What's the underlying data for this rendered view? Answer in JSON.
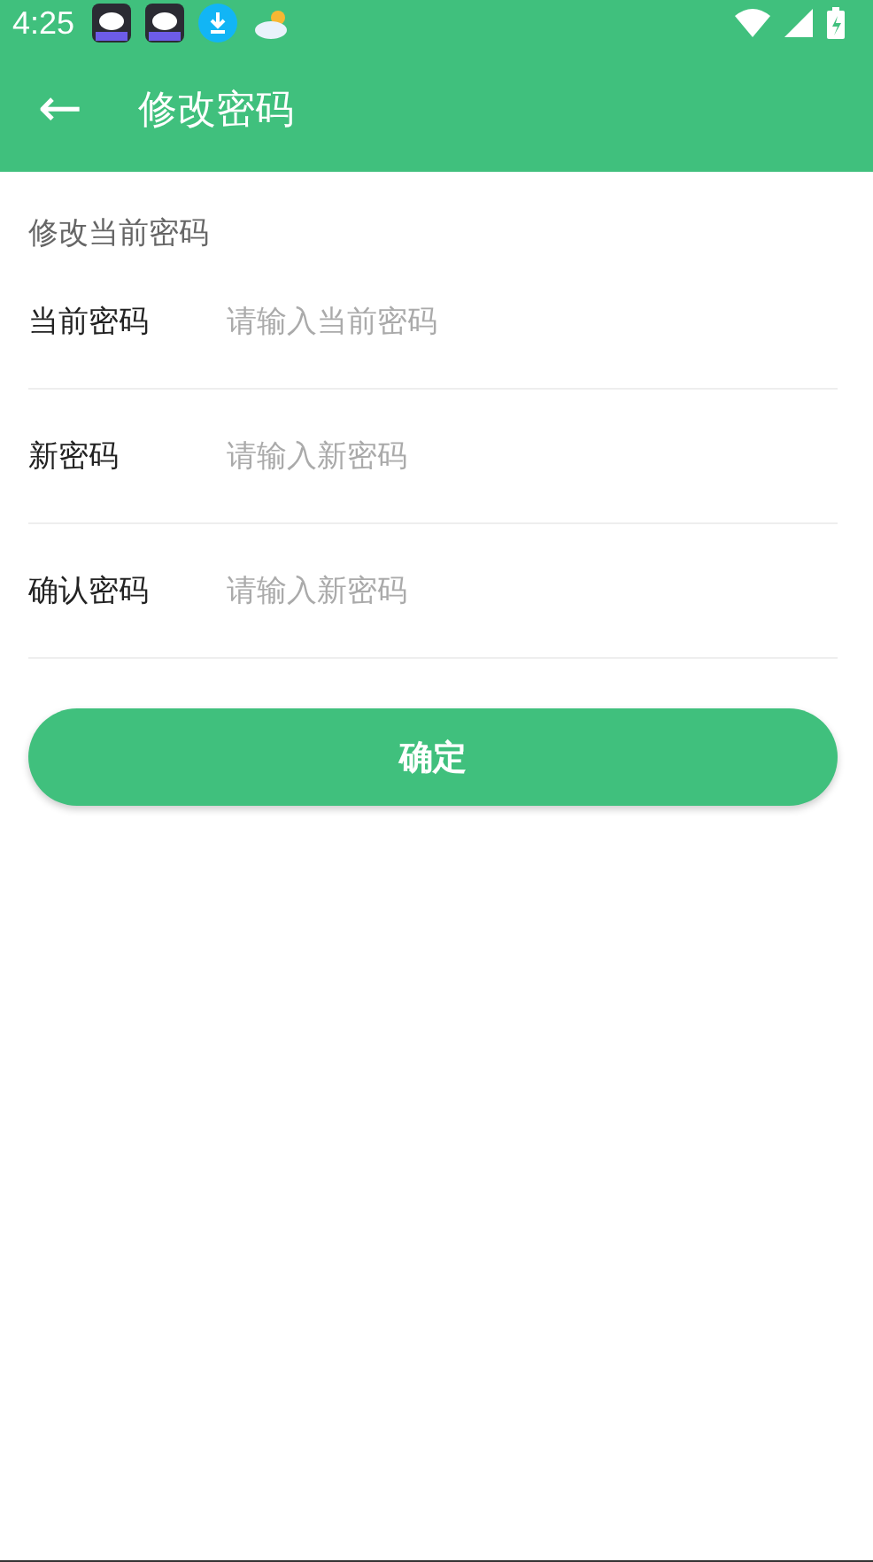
{
  "status_bar": {
    "time": "4:25"
  },
  "app_bar": {
    "back_icon": "←",
    "title": "修改密码"
  },
  "section_title": "修改当前密码",
  "fields": [
    {
      "label": "当前密码",
      "placeholder": "请输入当前密码"
    },
    {
      "label": "新密码",
      "placeholder": "请输入新密码"
    },
    {
      "label": "确认密码",
      "placeholder": "请输入新密码"
    }
  ],
  "submit_button": "确定"
}
